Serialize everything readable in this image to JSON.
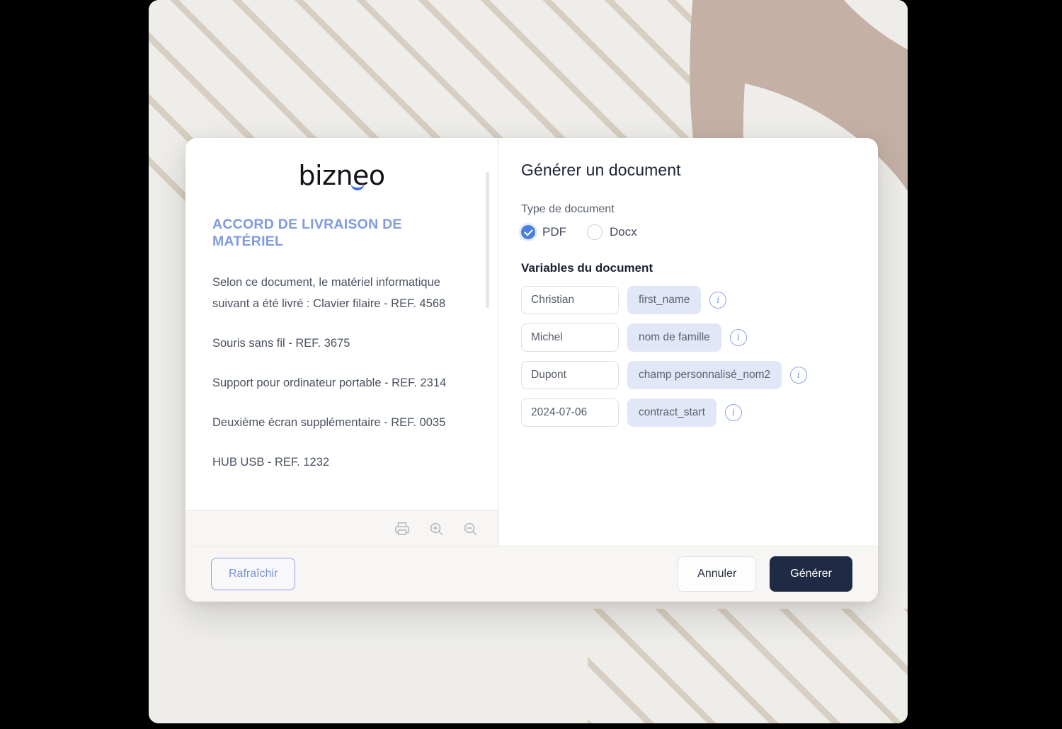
{
  "document_preview": {
    "logo_text": "bizneo",
    "title": "ACCORD DE LIVRAISON DE MATÉRIEL",
    "paragraphs": [
      "Selon ce document, le matériel informatique suivant a été livré : Clavier filaire - REF. 4568",
      "Souris sans fil - REF. 3675",
      "Support pour ordinateur portable - REF. 2314",
      "Deuxième écran supplémentaire - REF. 0035",
      "HUB USB - REF. 1232"
    ],
    "toolbar": {
      "print": "print-icon",
      "zoom_in": "zoom-in-icon",
      "zoom_out": "zoom-out-icon"
    }
  },
  "form": {
    "title": "Générer un document",
    "doc_type_label": "Type de document",
    "doc_type_options": [
      {
        "label": "PDF",
        "selected": true
      },
      {
        "label": "Docx",
        "selected": false
      }
    ],
    "variables_title": "Variables du document",
    "variables": [
      {
        "value": "Christian",
        "placeholder": "",
        "tag": "first_name",
        "info": "info-icon"
      },
      {
        "value": "Michel",
        "placeholder": "",
        "tag": "nom de famille",
        "info": "info-icon"
      },
      {
        "value": "Dupont",
        "placeholder": "",
        "tag": "champ personnalisé_nom2",
        "info": "info-icon"
      },
      {
        "value": "2024-07-06",
        "placeholder": "",
        "tag": "contract_start",
        "info": "info-icon"
      }
    ]
  },
  "footer": {
    "refresh_label": "Rafraîchir",
    "cancel_label": "Annuler",
    "generate_label": "Générer"
  },
  "colors": {
    "accent_blue": "#4a7fe0",
    "title_blue": "#7f9ade",
    "tag_bg": "#e2e7f8",
    "generate_bg": "#1f2b45",
    "background_cream": "#eeedea",
    "stripe_beige": "#c9bca9",
    "shape_taupe": "#c4b0a5"
  }
}
